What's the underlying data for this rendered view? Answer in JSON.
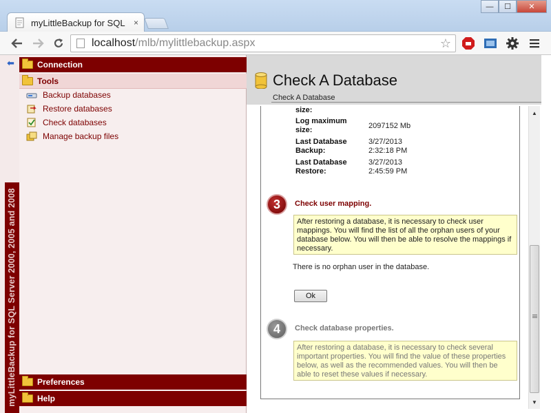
{
  "browser": {
    "tab_title": "myLittleBackup for SQL Se",
    "tab_close": "×",
    "url_host": "localhost",
    "url_path": "/mlb/mylittlebackup.aspx",
    "window_buttons": {
      "minimize": "—",
      "maximize": "☐",
      "close": "✕"
    },
    "icons": [
      "back-icon",
      "forward-icon",
      "reload-icon",
      "star-icon",
      "adblock-icon",
      "extension-icon",
      "settings-icon",
      "menu-icon"
    ]
  },
  "app": {
    "vertical_title": "myLittleBackup for SQL Server 2000, 2005 and 2008",
    "accent_color": "#7d0000"
  },
  "sidebar": {
    "sections": {
      "connection": "Connection",
      "tools": "Tools",
      "preferences": "Preferences",
      "help": "Help"
    },
    "tools": [
      {
        "label": "Backup databases",
        "icon": "backup-icon"
      },
      {
        "label": "Restore databases",
        "icon": "restore-icon"
      },
      {
        "label": "Check databases",
        "icon": "check-icon"
      },
      {
        "label": "Manage backup files",
        "icon": "manage-files-icon"
      }
    ]
  },
  "main": {
    "title": "Check A Database",
    "breadcrumb": "Check A Database",
    "properties": [
      {
        "label_1": "size:",
        "label_2": "",
        "value_1": "",
        "value_2": ""
      },
      {
        "label_1": "Log maximum",
        "label_2": "size:",
        "value_1": "2097152 Mb",
        "value_2": ""
      },
      {
        "label_1": "Last Database",
        "label_2": "Backup:",
        "value_1": "3/27/2013",
        "value_2": "2:32:18 PM"
      },
      {
        "label_1": "Last Database",
        "label_2": "Restore:",
        "value_1": "3/27/2013",
        "value_2": "2:45:59 PM"
      }
    ],
    "step3": {
      "number": "3",
      "title": "Check user mapping.",
      "info": "After restoring a database, it is necessary to check user mappings. You will find the list of all the orphan users of your database below. You will then be able to resolve the mappings if necessary.",
      "status": "There is no orphan user in the database.",
      "ok_label": "Ok"
    },
    "step4": {
      "number": "4",
      "title": "Check database properties.",
      "info": "After restoring a database, it is necessary to check several important properties. You will find the value of these properties below, as well as the recommended values. You will then be able to reset these values if necessary."
    }
  }
}
